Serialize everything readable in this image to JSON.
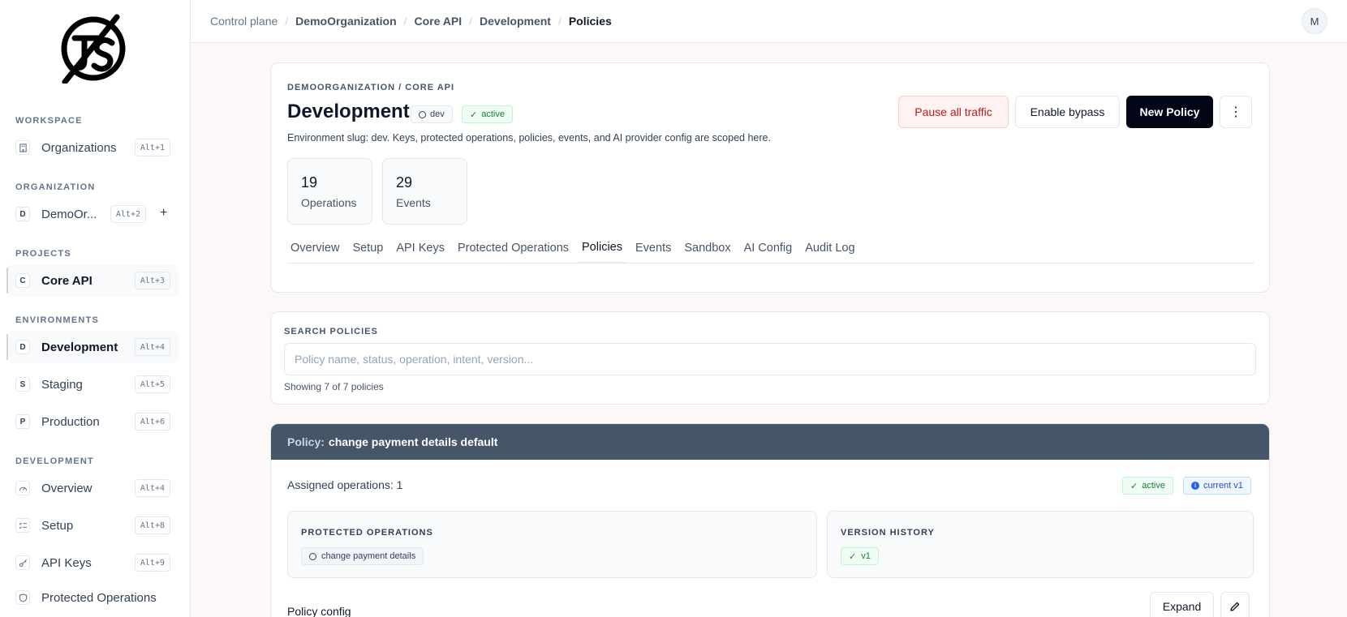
{
  "breadcrumb": [
    {
      "label": "Control plane"
    },
    {
      "label": "DemoOrganization"
    },
    {
      "label": "Core API"
    },
    {
      "label": "Development"
    },
    {
      "label": "Policies"
    }
  ],
  "user": {
    "initial": "M"
  },
  "sidebar": {
    "sections": {
      "workspace": "WORKSPACE",
      "organization": "ORGANIZATION",
      "projects": "PROJECTS",
      "environments": "ENVIRONMENTS",
      "development": "DEVELOPMENT"
    },
    "organizations": {
      "label": "Organizations",
      "shortcut": "Alt+1"
    },
    "org": {
      "letter": "D",
      "label": "DemoOr...",
      "shortcut": "Alt+2",
      "add": "+"
    },
    "project": {
      "letter": "C",
      "label": "Core API",
      "shortcut": "Alt+3"
    },
    "environments": [
      {
        "letter": "D",
        "label": "Development",
        "shortcut": "Alt+4"
      },
      {
        "letter": "S",
        "label": "Staging",
        "shortcut": "Alt+5"
      },
      {
        "letter": "P",
        "label": "Production",
        "shortcut": "Alt+6"
      }
    ],
    "dev_items": [
      {
        "label": "Overview",
        "shortcut": "Alt+4"
      },
      {
        "label": "Setup",
        "shortcut": "Alt+8"
      },
      {
        "label": "API Keys",
        "shortcut": "Alt+9"
      },
      {
        "label": "Protected Operations"
      }
    ]
  },
  "environment": {
    "eyebrow": "DEMOORGANIZATION / CORE API",
    "title": "Development",
    "badge_env": "dev",
    "badge_status": "active",
    "description": "Environment slug: dev. Keys, protected operations, policies, events, and AI provider config are scoped here.",
    "actions": {
      "pause": "Pause all traffic",
      "bypass": "Enable bypass",
      "new_policy": "New Policy",
      "more": "⋮"
    },
    "stats": [
      {
        "value": "19",
        "label": "Operations"
      },
      {
        "value": "29",
        "label": "Events"
      }
    ],
    "tabs": [
      "Overview",
      "Setup",
      "API Keys",
      "Protected Operations",
      "Policies",
      "Events",
      "Sandbox",
      "AI Config",
      "Audit Log"
    ],
    "active_tab": "Policies"
  },
  "search": {
    "label": "SEARCH POLICIES",
    "placeholder": "Policy name, status, operation, intent, version...",
    "value": "",
    "count": "Showing 7 of 7 policies"
  },
  "policy": {
    "prefix": "Policy:",
    "name": "change payment details default",
    "assigned": "Assigned operations: 1",
    "status": "active",
    "version": "current v1",
    "protected_title": "PROTECTED OPERATIONS",
    "protected_ops": [
      "change payment details"
    ],
    "history_title": "VERSION HISTORY",
    "versions": [
      "v1"
    ],
    "config_label": "Policy config",
    "expand": "Expand"
  },
  "colors": {
    "primary": "#020617",
    "danger": "#b91c1c",
    "success": "#15803d",
    "info": "#1d4ed8",
    "policy_header": "#475569"
  }
}
